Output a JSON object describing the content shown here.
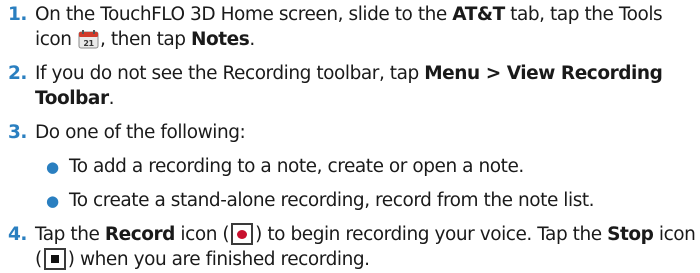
{
  "steps": [
    {
      "num": "1.",
      "t1": "On the TouchFLO 3D Home screen, slide to the ",
      "b1": "AT&T",
      "t2": " tab, tap the Tools icon ",
      "t3": ", then tap ",
      "b2": "Notes",
      "t4": "."
    },
    {
      "num": "2.",
      "t1": "If you do not see the Recording toolbar, tap ",
      "b1": "Menu > View Recording Toolbar",
      "t2": "."
    },
    {
      "num": "3.",
      "t1": "Do one of the following:",
      "subs": [
        "To add a recording to a note, create or open a note.",
        "To create a stand-alone recording, record from the note list."
      ]
    },
    {
      "num": "4.",
      "t1": "Tap the ",
      "b1": "Record",
      "t2": " icon (",
      "t3": ") to begin recording your voice. Tap the ",
      "b2": "Stop",
      "t4": " icon (",
      "t5": ") when you are finished recording."
    }
  ],
  "icons": {
    "tools_icon": "tools-calendar-icon",
    "record_icon": "record-icon",
    "stop_icon": "stop-icon",
    "tools_icon_text": "21"
  },
  "colors": {
    "accent": "#2a7fc0",
    "record_red": "#c8102e",
    "text": "#1a1a1a"
  }
}
